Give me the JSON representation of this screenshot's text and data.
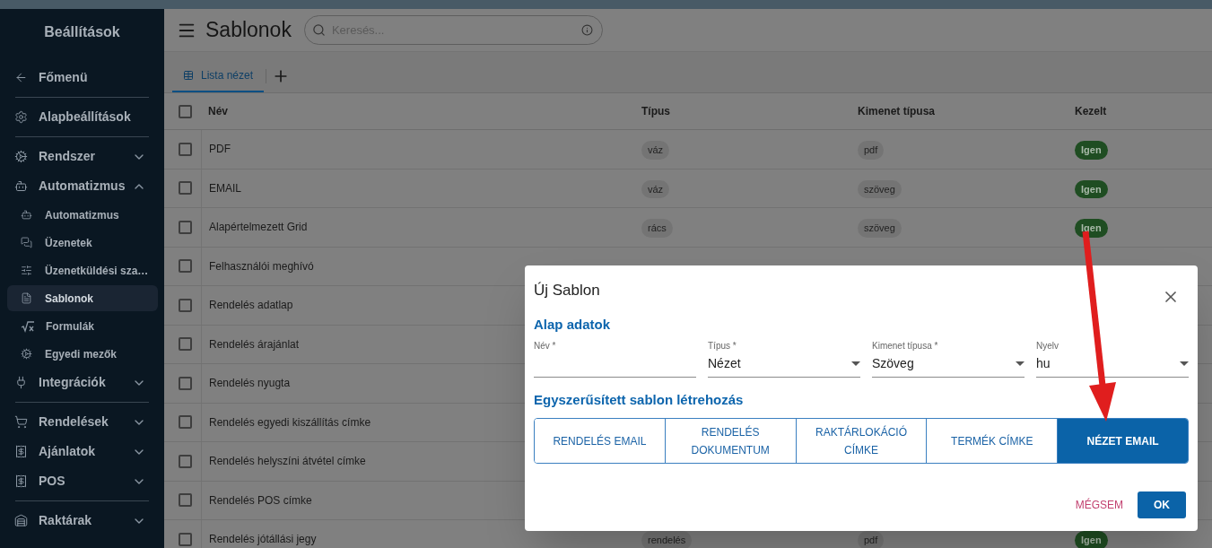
{
  "sidebar": {
    "title": "Beállítások",
    "sections": [
      [
        {
          "kind": "back",
          "label": "Főmenü",
          "selected": false
        }
      ],
      [
        {
          "kind": "link",
          "label": "Alapbeállítások",
          "selected": false
        }
      ],
      [
        {
          "kind": "group",
          "label": "Rendszer",
          "expanded": false,
          "selected": false
        },
        {
          "kind": "group",
          "label": "Automatizmus",
          "expanded": true,
          "selected": false,
          "children": [
            {
              "label": "Automatizmus",
              "selected": false
            },
            {
              "label": "Üzenetek",
              "selected": false
            },
            {
              "label": "Üzenetküldési sza…",
              "selected": false
            },
            {
              "label": "Sablonok",
              "selected": true
            },
            {
              "label": "Formulák",
              "selected": false
            },
            {
              "label": "Egyedi mezők",
              "selected": false
            }
          ]
        },
        {
          "kind": "group",
          "label": "Integrációk",
          "expanded": false,
          "selected": false
        }
      ],
      [
        {
          "kind": "group",
          "label": "Rendelések",
          "expanded": false,
          "selected": false
        },
        {
          "kind": "group",
          "label": "Ajánlatok",
          "expanded": false,
          "selected": false
        },
        {
          "kind": "group",
          "label": "POS",
          "expanded": false,
          "selected": false
        }
      ],
      [
        {
          "kind": "group",
          "label": "Raktárak",
          "expanded": false,
          "selected": false
        }
      ]
    ]
  },
  "header": {
    "title": "Sablonok",
    "search": {
      "placeholder": "Keresés..."
    }
  },
  "tabs": [
    {
      "label": "Lista nézet",
      "selected": true
    }
  ],
  "table": {
    "header_checked": false,
    "columns": [
      "Név",
      "Típus",
      "Kimenet típusa",
      "Kezelt"
    ],
    "rows": [
      {
        "checked": false,
        "name": "PDF",
        "type": "váz",
        "output": "pdf",
        "managed": "Igen"
      },
      {
        "checked": false,
        "name": "EMAIL",
        "type": "váz",
        "output": "szöveg",
        "managed": "Igen"
      },
      {
        "checked": false,
        "name": "Alapértelmezett Grid",
        "type": "rács",
        "output": "szöveg",
        "managed": "Igen"
      },
      {
        "checked": false,
        "name": "Felhasználói meghívó"
      },
      {
        "checked": false,
        "name": "Rendelés adatlap"
      },
      {
        "checked": false,
        "name": "Rendelés árajánlat"
      },
      {
        "checked": false,
        "name": "Rendelés nyugta"
      },
      {
        "checked": false,
        "name": "Rendelés egyedi kiszállítás címke"
      },
      {
        "checked": false,
        "name": "Rendelés helyszíni átvétel címke"
      },
      {
        "checked": false,
        "name": "Rendelés POS címke"
      },
      {
        "checked": false,
        "name": "Rendelés jótállási jegy",
        "type": "rendelés",
        "output": "pdf",
        "managed": "Igen"
      }
    ]
  },
  "dialog": {
    "title": "Új Sablon",
    "section_basic": "Alap adatok",
    "fields": [
      {
        "kind": "text",
        "label": "Név *"
      },
      {
        "kind": "select",
        "label": "Típus *",
        "value": "Nézet"
      },
      {
        "kind": "select",
        "label": "Kimenet típusa *",
        "value": "Szöveg"
      },
      {
        "kind": "select",
        "label": "Nyelv",
        "value": "hu"
      }
    ],
    "section_templates": "Egyszerűsített sablon létrehozás",
    "templates": [
      {
        "label": "RENDELÉS EMAIL",
        "selected": false
      },
      {
        "label": "RENDELÉS DOKUMENTUM",
        "selected": false
      },
      {
        "label": "RAKTÁRLOKÁCIÓ CÍMKE",
        "selected": false
      },
      {
        "label": "TERMÉK CÍMKE",
        "selected": false
      },
      {
        "label": "NÉZET EMAIL",
        "selected": true
      }
    ],
    "cancel": "MÉGSEM",
    "ok": "OK"
  }
}
